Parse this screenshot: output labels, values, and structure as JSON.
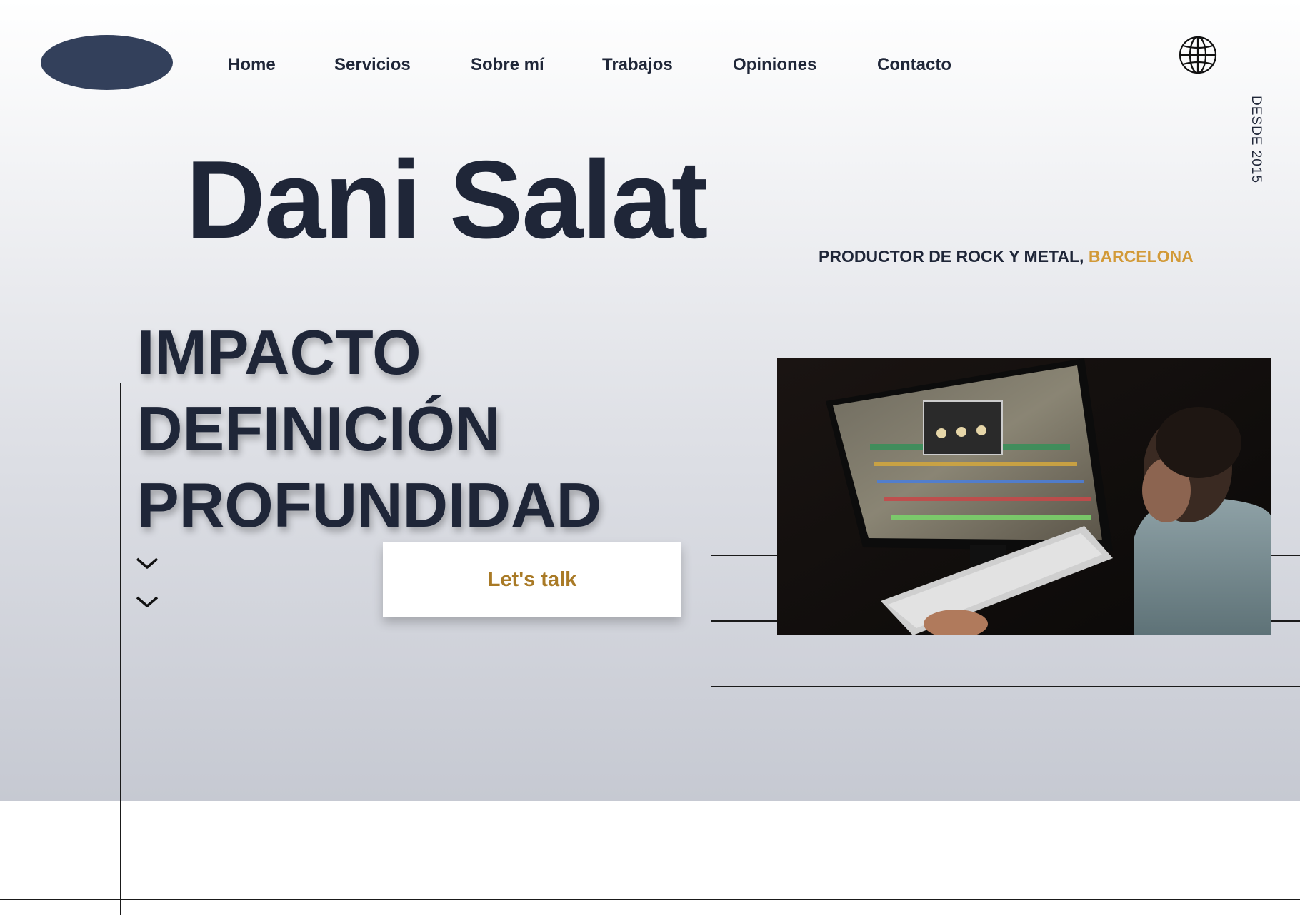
{
  "nav": {
    "logo_label": "",
    "items": [
      "Home",
      "Servicios",
      "Sobre mí",
      "Trabajos",
      "Opiniones",
      "Contacto"
    ]
  },
  "hero": {
    "since": "DESDE 2015",
    "name": "Dani Salat",
    "tagline_main": "PRODUCTOR DE ROCK Y METAL, ",
    "tagline_city": "BARCELONA",
    "words": [
      "IMPACTO",
      "DEFINICIÓN",
      "PROFUNDIDAD"
    ],
    "cta_label": "Let's talk"
  },
  "icons": {
    "globe": "globe-icon",
    "scroll": "chevron-down-icon"
  },
  "colors": {
    "text": "#1f2638",
    "accent": "#d29a38",
    "cta_text": "#a97a26",
    "logo": "#33405b"
  }
}
